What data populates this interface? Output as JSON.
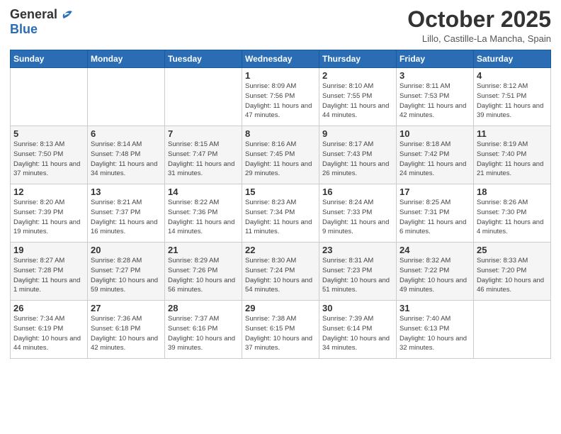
{
  "header": {
    "logo_general": "General",
    "logo_blue": "Blue",
    "month_title": "October 2025",
    "location": "Lillo, Castille-La Mancha, Spain"
  },
  "weekdays": [
    "Sunday",
    "Monday",
    "Tuesday",
    "Wednesday",
    "Thursday",
    "Friday",
    "Saturday"
  ],
  "weeks": [
    [
      {
        "day": "",
        "info": ""
      },
      {
        "day": "",
        "info": ""
      },
      {
        "day": "",
        "info": ""
      },
      {
        "day": "1",
        "info": "Sunrise: 8:09 AM\nSunset: 7:56 PM\nDaylight: 11 hours\nand 47 minutes."
      },
      {
        "day": "2",
        "info": "Sunrise: 8:10 AM\nSunset: 7:55 PM\nDaylight: 11 hours\nand 44 minutes."
      },
      {
        "day": "3",
        "info": "Sunrise: 8:11 AM\nSunset: 7:53 PM\nDaylight: 11 hours\nand 42 minutes."
      },
      {
        "day": "4",
        "info": "Sunrise: 8:12 AM\nSunset: 7:51 PM\nDaylight: 11 hours\nand 39 minutes."
      }
    ],
    [
      {
        "day": "5",
        "info": "Sunrise: 8:13 AM\nSunset: 7:50 PM\nDaylight: 11 hours\nand 37 minutes."
      },
      {
        "day": "6",
        "info": "Sunrise: 8:14 AM\nSunset: 7:48 PM\nDaylight: 11 hours\nand 34 minutes."
      },
      {
        "day": "7",
        "info": "Sunrise: 8:15 AM\nSunset: 7:47 PM\nDaylight: 11 hours\nand 31 minutes."
      },
      {
        "day": "8",
        "info": "Sunrise: 8:16 AM\nSunset: 7:45 PM\nDaylight: 11 hours\nand 29 minutes."
      },
      {
        "day": "9",
        "info": "Sunrise: 8:17 AM\nSunset: 7:43 PM\nDaylight: 11 hours\nand 26 minutes."
      },
      {
        "day": "10",
        "info": "Sunrise: 8:18 AM\nSunset: 7:42 PM\nDaylight: 11 hours\nand 24 minutes."
      },
      {
        "day": "11",
        "info": "Sunrise: 8:19 AM\nSunset: 7:40 PM\nDaylight: 11 hours\nand 21 minutes."
      }
    ],
    [
      {
        "day": "12",
        "info": "Sunrise: 8:20 AM\nSunset: 7:39 PM\nDaylight: 11 hours\nand 19 minutes."
      },
      {
        "day": "13",
        "info": "Sunrise: 8:21 AM\nSunset: 7:37 PM\nDaylight: 11 hours\nand 16 minutes."
      },
      {
        "day": "14",
        "info": "Sunrise: 8:22 AM\nSunset: 7:36 PM\nDaylight: 11 hours\nand 14 minutes."
      },
      {
        "day": "15",
        "info": "Sunrise: 8:23 AM\nSunset: 7:34 PM\nDaylight: 11 hours\nand 11 minutes."
      },
      {
        "day": "16",
        "info": "Sunrise: 8:24 AM\nSunset: 7:33 PM\nDaylight: 11 hours\nand 9 minutes."
      },
      {
        "day": "17",
        "info": "Sunrise: 8:25 AM\nSunset: 7:31 PM\nDaylight: 11 hours\nand 6 minutes."
      },
      {
        "day": "18",
        "info": "Sunrise: 8:26 AM\nSunset: 7:30 PM\nDaylight: 11 hours\nand 4 minutes."
      }
    ],
    [
      {
        "day": "19",
        "info": "Sunrise: 8:27 AM\nSunset: 7:28 PM\nDaylight: 11 hours\nand 1 minute."
      },
      {
        "day": "20",
        "info": "Sunrise: 8:28 AM\nSunset: 7:27 PM\nDaylight: 10 hours\nand 59 minutes."
      },
      {
        "day": "21",
        "info": "Sunrise: 8:29 AM\nSunset: 7:26 PM\nDaylight: 10 hours\nand 56 minutes."
      },
      {
        "day": "22",
        "info": "Sunrise: 8:30 AM\nSunset: 7:24 PM\nDaylight: 10 hours\nand 54 minutes."
      },
      {
        "day": "23",
        "info": "Sunrise: 8:31 AM\nSunset: 7:23 PM\nDaylight: 10 hours\nand 51 minutes."
      },
      {
        "day": "24",
        "info": "Sunrise: 8:32 AM\nSunset: 7:22 PM\nDaylight: 10 hours\nand 49 minutes."
      },
      {
        "day": "25",
        "info": "Sunrise: 8:33 AM\nSunset: 7:20 PM\nDaylight: 10 hours\nand 46 minutes."
      }
    ],
    [
      {
        "day": "26",
        "info": "Sunrise: 7:34 AM\nSunset: 6:19 PM\nDaylight: 10 hours\nand 44 minutes."
      },
      {
        "day": "27",
        "info": "Sunrise: 7:36 AM\nSunset: 6:18 PM\nDaylight: 10 hours\nand 42 minutes."
      },
      {
        "day": "28",
        "info": "Sunrise: 7:37 AM\nSunset: 6:16 PM\nDaylight: 10 hours\nand 39 minutes."
      },
      {
        "day": "29",
        "info": "Sunrise: 7:38 AM\nSunset: 6:15 PM\nDaylight: 10 hours\nand 37 minutes."
      },
      {
        "day": "30",
        "info": "Sunrise: 7:39 AM\nSunset: 6:14 PM\nDaylight: 10 hours\nand 34 minutes."
      },
      {
        "day": "31",
        "info": "Sunrise: 7:40 AM\nSunset: 6:13 PM\nDaylight: 10 hours\nand 32 minutes."
      },
      {
        "day": "",
        "info": ""
      }
    ]
  ]
}
